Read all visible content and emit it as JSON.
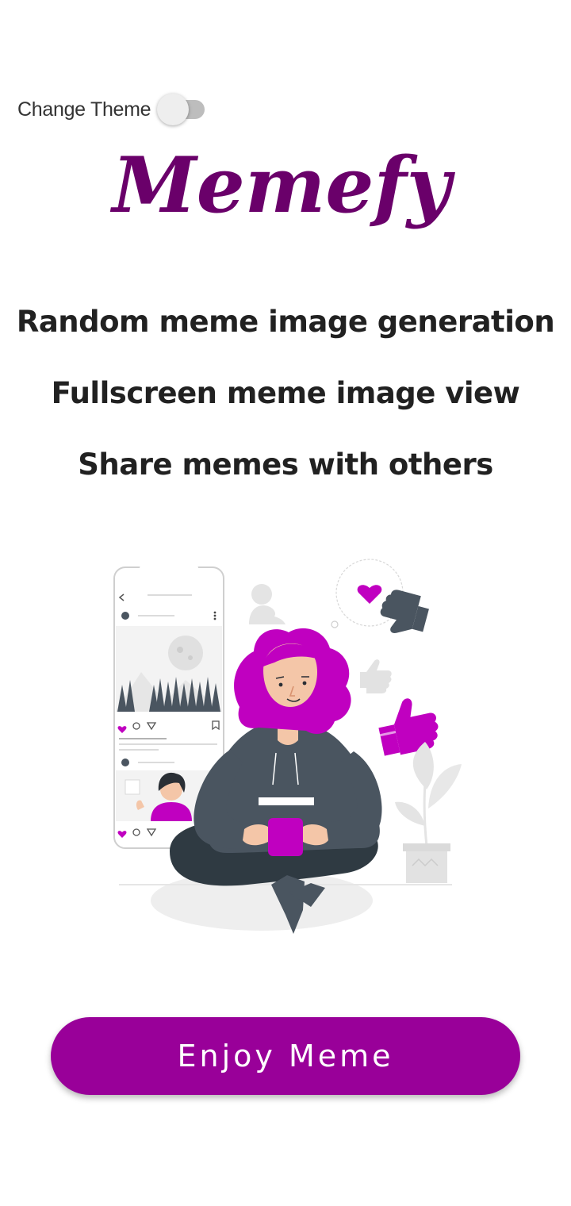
{
  "theme_toggle": {
    "label": "Change Theme",
    "state": "off"
  },
  "logo": {
    "text": "Memefy",
    "color": "#6a006a"
  },
  "features": [
    "Random meme image generation",
    "Fullscreen meme image view",
    "Share memes with others"
  ],
  "illustration": {
    "name": "person-with-phone-illustration",
    "accent_color": "#c000c0"
  },
  "cta": {
    "label": "Enjoy Meme",
    "color": "#990099"
  }
}
